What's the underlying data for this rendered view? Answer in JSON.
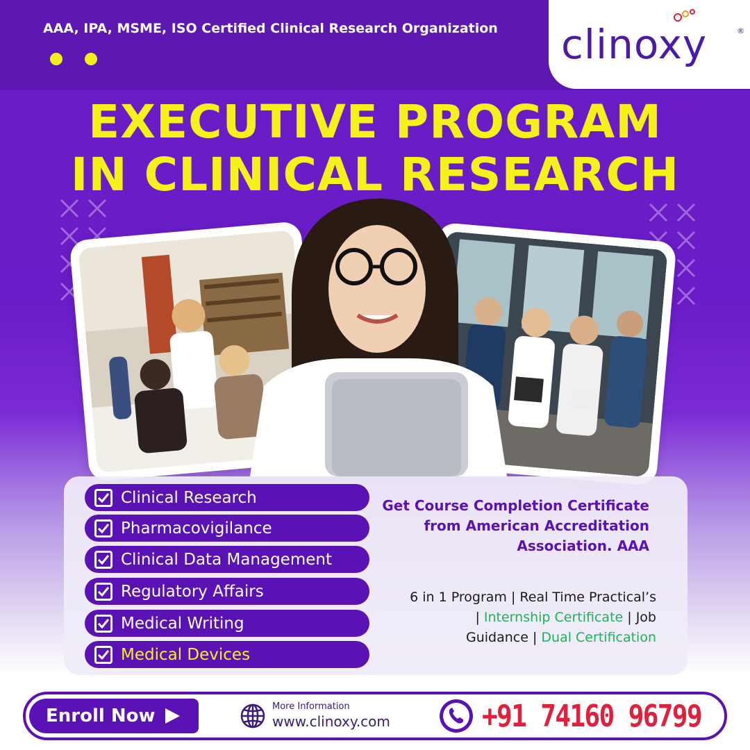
{
  "header": {
    "certification": "AAA, IPA, MSME, ISO Certified Clinical Research Organization",
    "logo": "clinoxy",
    "logo_registered": "®"
  },
  "headline": {
    "line1": "EXECUTIVE PROGRAM",
    "line2": "IN CLINICAL RESEARCH"
  },
  "courses": [
    {
      "label": "Clinical Research"
    },
    {
      "label": "Pharmacovigilance"
    },
    {
      "label": "Clinical Data Management"
    },
    {
      "label": "Regulatory Affairs"
    },
    {
      "label": "Medical Writing"
    },
    {
      "label": "Medical Devices"
    }
  ],
  "certificate_copy": {
    "line1": "Get Course Completion Certificate",
    "line2": "from American Accreditation",
    "line3": "Association. AAA"
  },
  "program_copy": {
    "line1": "6 in 1 Program | Real Time Practical’s",
    "line2_prefix": "| ",
    "line2_green": "Internship Certificate",
    "line2_suffix": " | Job",
    "line3_prefix": "Guidance | ",
    "line3_green": "Dual Certification"
  },
  "footer": {
    "enroll_label": "Enroll Now",
    "more_info_label": "More Information",
    "website": "www.clinoxy.com",
    "phone": "+91 74160 96799"
  },
  "colors": {
    "brand_purple": "#5b12b4",
    "headline_yellow": "#f5f21a",
    "phone_red": "#e0213b",
    "highlight_green": "#1bb358"
  }
}
